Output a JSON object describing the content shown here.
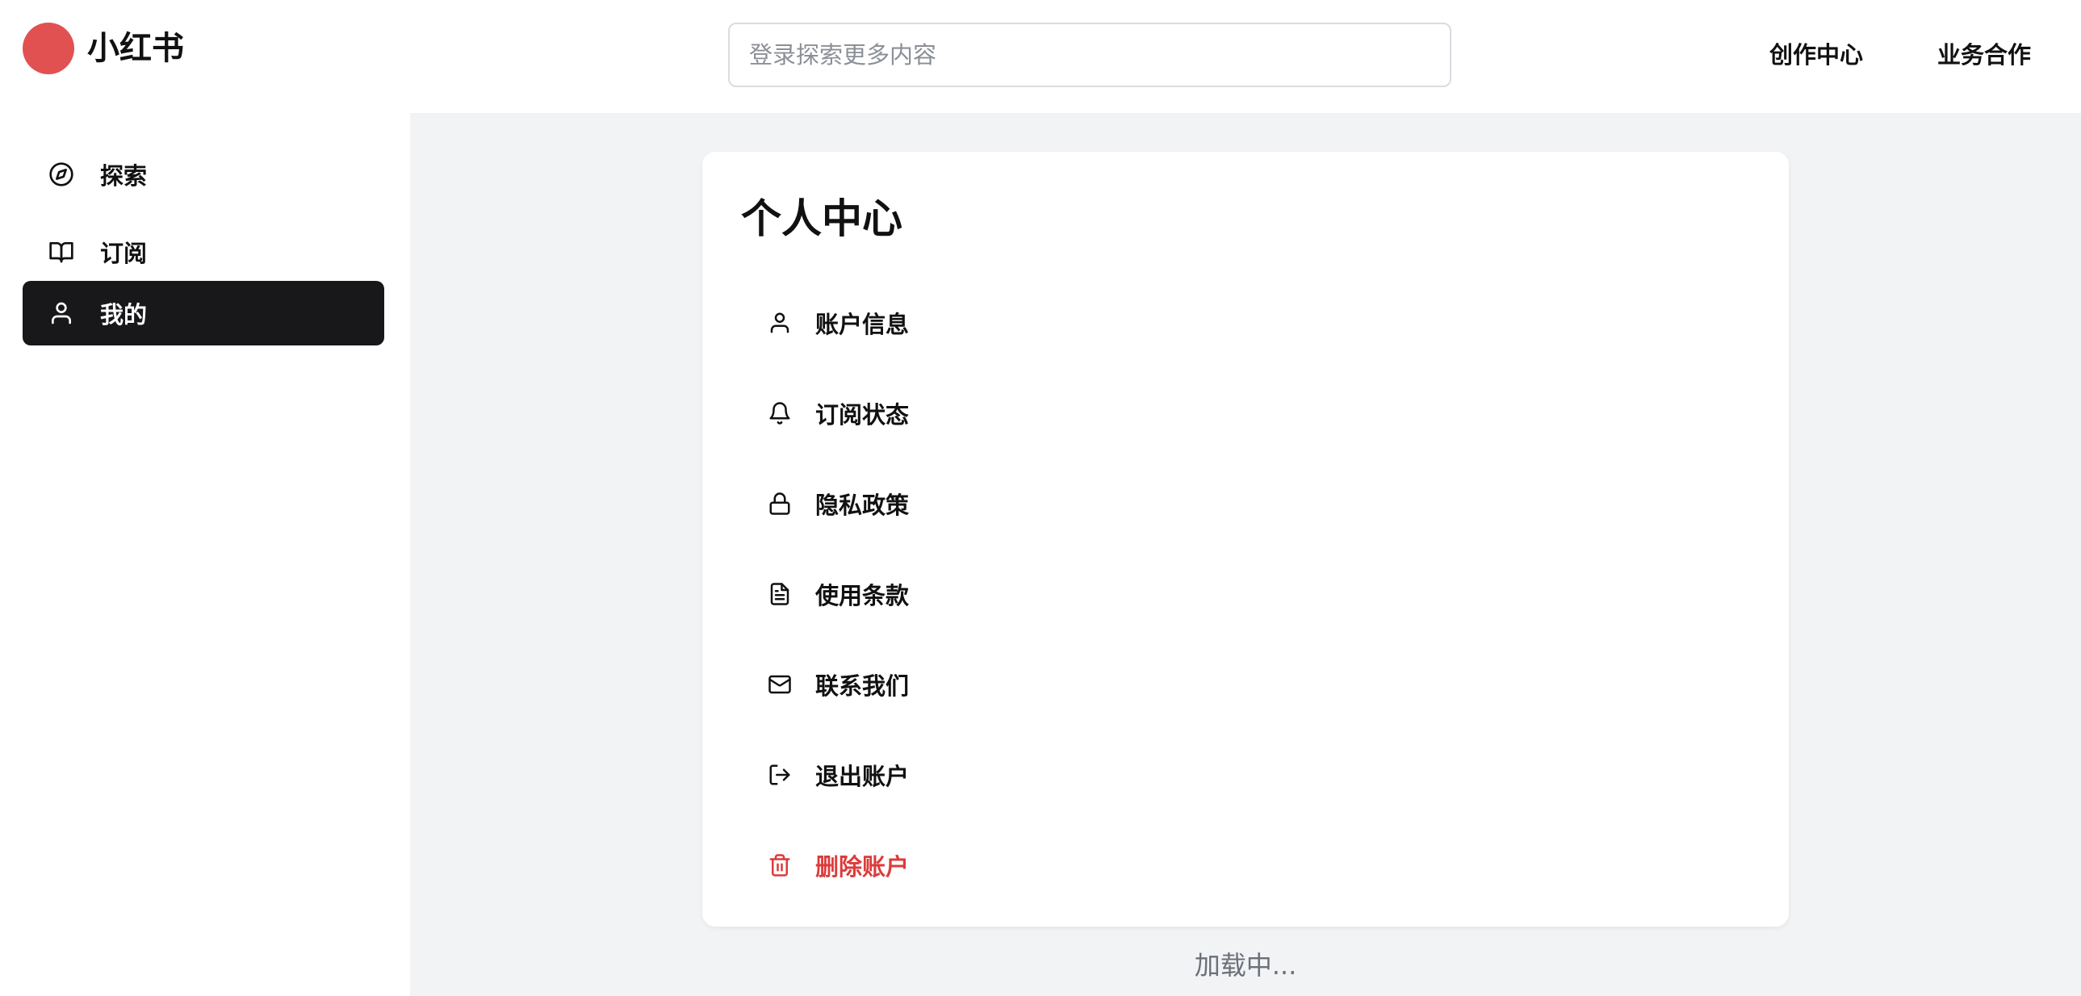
{
  "header": {
    "app_title": "小红书",
    "brand_color": "#e15151",
    "search_placeholder": "登录探索更多内容",
    "links": [
      "创作中心",
      "业务合作"
    ]
  },
  "sidebar": {
    "items": [
      {
        "label": "探索",
        "icon": "compass-icon",
        "active": false
      },
      {
        "label": "订阅",
        "icon": "book-icon",
        "active": false
      },
      {
        "label": "我的",
        "icon": "user-icon",
        "active": true
      }
    ]
  },
  "main": {
    "card_title": "个人中心",
    "menu": [
      {
        "label": "账户信息",
        "icon": "user-icon"
      },
      {
        "label": "订阅状态",
        "icon": "bell-icon"
      },
      {
        "label": "隐私政策",
        "icon": "lock-icon"
      },
      {
        "label": "使用条款",
        "icon": "document-icon"
      },
      {
        "label": "联系我们",
        "icon": "mail-icon"
      },
      {
        "label": "退出账户",
        "icon": "logout-icon"
      },
      {
        "label": "删除账户",
        "icon": "trash-icon",
        "danger_color": "#dc3b3b"
      }
    ],
    "loading_text": "加载中..."
  }
}
